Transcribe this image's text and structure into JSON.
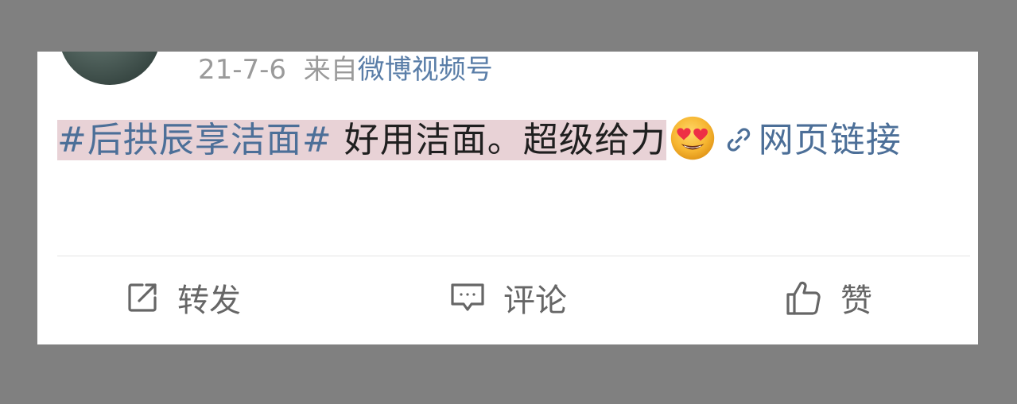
{
  "post": {
    "date": "21-7-6",
    "source_prefix": "来自",
    "source": "微博视频号",
    "topic": "#后拱辰享洁面#",
    "text": " 好用洁面。超级给力",
    "emoji": "heart-eyes-emoji",
    "link_label": "网页链接"
  },
  "actions": {
    "repost_label": "转发",
    "comment_label": "评论",
    "like_label": "赞"
  },
  "colors": {
    "link": "#4c6f98",
    "highlight": "#e8d2d6",
    "meta_text": "#9a9a9a",
    "background": "#808080"
  }
}
